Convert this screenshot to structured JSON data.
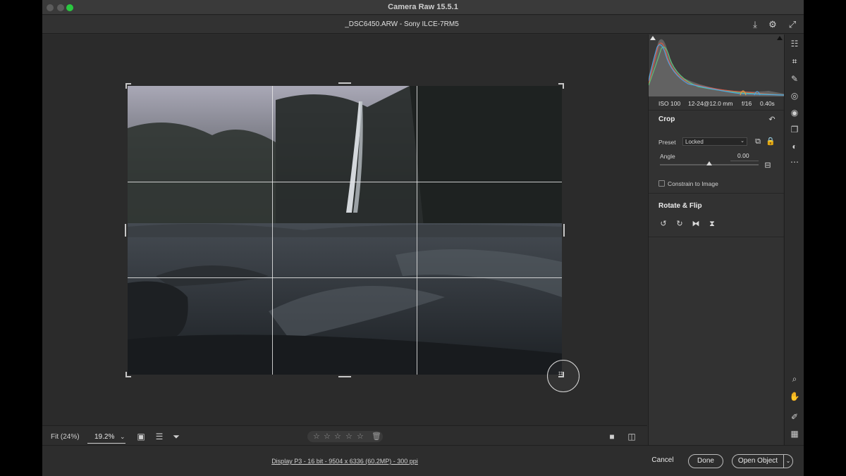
{
  "window": {
    "title": "Camera Raw 15.5.1"
  },
  "file": {
    "name": "_DSC6450.ARW  -  Sony ILCE-7RM5"
  },
  "toolbar_icons": [
    "save-icon",
    "gear-icon",
    "expand-icon"
  ],
  "bottom": {
    "fit_label": "Fit (24%)",
    "zoom_value": "19.2%",
    "stars": [
      "☆",
      "☆",
      "☆",
      "☆",
      "☆"
    ]
  },
  "status": {
    "info": "Display P3 - 16 bit - 9504 x 6336 (60.2MP) - 300 ppi"
  },
  "buttons": {
    "cancel": "Cancel",
    "done": "Done",
    "open": "Open Object"
  },
  "exif": {
    "iso": "ISO 100",
    "lens": "12-24@12.0 mm",
    "aperture": "f/16",
    "shutter": "0.40s"
  },
  "crop": {
    "title": "Crop",
    "preset_label": "Preset",
    "preset_value": "Locked",
    "angle_label": "Angle",
    "angle_value": "0.00",
    "angle_slider": 0.5,
    "constrain_label": "Constrain to Image",
    "constrain_checked": false
  },
  "rotate": {
    "title": "Rotate & Flip"
  },
  "colors": {
    "accent": "#2ac840",
    "panel": "#323232",
    "canvas": "#2b2b2b"
  }
}
